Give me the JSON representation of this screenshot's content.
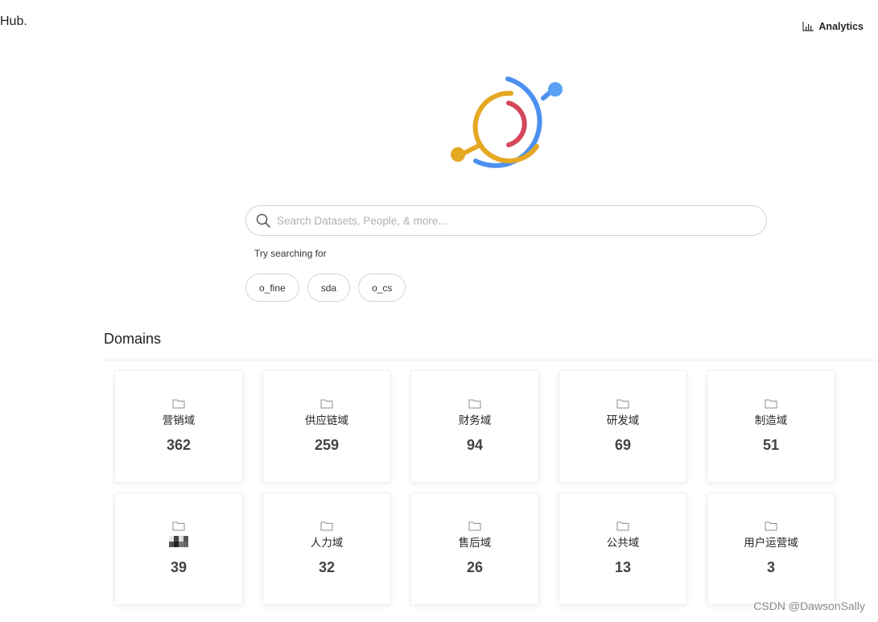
{
  "header": {
    "brand": "Hub.",
    "analytics_label": "Analytics",
    "analytics_icon": "bar-chart-icon"
  },
  "logo": {
    "colors": {
      "outer": "#4d90f0",
      "middle": "#e5a823",
      "inner": "#d5475a"
    }
  },
  "search": {
    "placeholder": "Search Datasets, People, & more...",
    "value": "",
    "icon": "search-icon"
  },
  "suggestions": {
    "label": "Try searching for",
    "items": [
      "o_fine",
      "sda",
      "o_cs"
    ]
  },
  "domains": {
    "title": "Domains",
    "items": [
      {
        "name": "营销域",
        "count": "362"
      },
      {
        "name": "供应链域",
        "count": "259"
      },
      {
        "name": "财务域",
        "count": "94"
      },
      {
        "name": "研发域",
        "count": "69"
      },
      {
        "name": "制造域",
        "count": "51"
      },
      {
        "name": "",
        "count": "39",
        "name_obscured": true
      },
      {
        "name": "人力域",
        "count": "32"
      },
      {
        "name": "售后域",
        "count": "26"
      },
      {
        "name": "公共域",
        "count": "13"
      },
      {
        "name": "用户运营域",
        "count": "3"
      }
    ]
  },
  "watermark": "CSDN @DawsonSally"
}
